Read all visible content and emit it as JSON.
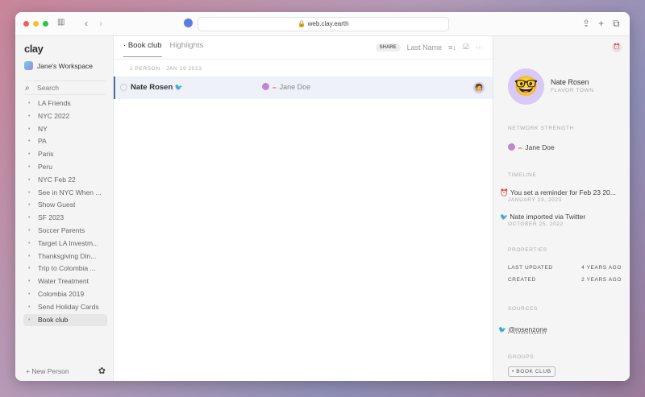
{
  "browser": {
    "url": "web.clay.earth"
  },
  "sidebar": {
    "logo": "clay",
    "workspace": "Jane's Workspace",
    "search_placeholder": "Search",
    "items": [
      "LA Friends",
      "NYC 2022",
      "NY",
      "PA",
      "Paris",
      "Peru",
      "NYC Feb 22",
      "See in NYC When ...",
      "Show Guest",
      "SF 2023",
      "Soccer Parents",
      "Target LA Investm...",
      "Thanksgiving Din...",
      "Trip to Colombia ...",
      "Water Treatment",
      "Colombia 2019",
      "Send Holiday Cards",
      "Book club"
    ],
    "active_item": "Book club",
    "new_person": "New Person"
  },
  "main": {
    "tabs": [
      "Book club",
      "Highlights"
    ],
    "share": "SHARE",
    "sort": "Last Name",
    "meta": "1 PERSON · JAN 19 2023",
    "rows": [
      {
        "name": "Nate Rosen",
        "connection": "Jane Doe"
      }
    ]
  },
  "detail": {
    "name": "Nate Rosen",
    "location": "FLAVOR TOWN",
    "network_label": "NETWORK STRENGTH",
    "network_person": "Jane Doe",
    "timeline_label": "TIMELINE",
    "timeline": [
      {
        "text": "You set a reminder for Feb 23 20...",
        "date": "JANUARY 23, 2023",
        "icon": "alarm-icon"
      },
      {
        "text": "Nate imported via Twitter",
        "date": "OCTOBER 25, 2022",
        "icon": "twitter-icon"
      }
    ],
    "properties_label": "PROPERTIES",
    "properties": [
      {
        "key": "LAST UPDATED",
        "value": "4 YEARS AGO"
      },
      {
        "key": "CREATED",
        "value": "2 YEARS AGO"
      }
    ],
    "sources_label": "SOURCES",
    "source": "@rosenzone",
    "groups_label": "GROUPS",
    "group": "BOOK CLUB"
  },
  "colors": {
    "accent": "#4a6fa5",
    "twitter": "#3a9be8",
    "row_highlight": "#eef1f8"
  }
}
